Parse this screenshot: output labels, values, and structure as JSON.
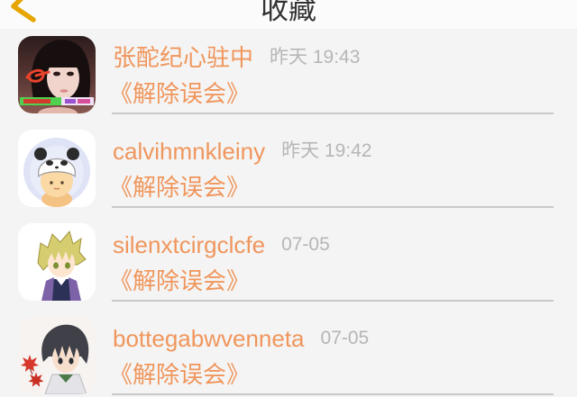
{
  "header": {
    "title": "收藏",
    "back_icon": "chevron-left-icon"
  },
  "colors": {
    "accent": "#e6a500",
    "name": "#f0965c",
    "subtitle": "#f0965c",
    "time": "#b6b6b6",
    "divider": "#c8c8c8",
    "header_bg": "#fbfbfb",
    "page_bg": "#f4f4f4",
    "title": "#333333"
  },
  "favorites": [
    {
      "name": "张酡纪心驻中",
      "time": "昨天 19:43",
      "subtitle": "《解除误会》"
    },
    {
      "name": "calvihmnkleiny",
      "time": "昨天 19:42",
      "subtitle": "《解除误会》"
    },
    {
      "name": "silenxtcirgclcfe",
      "time": "07-05",
      "subtitle": "《解除误会》"
    },
    {
      "name": "bottegabwvenneta",
      "time": "07-05",
      "subtitle": "《解除误会》"
    }
  ]
}
